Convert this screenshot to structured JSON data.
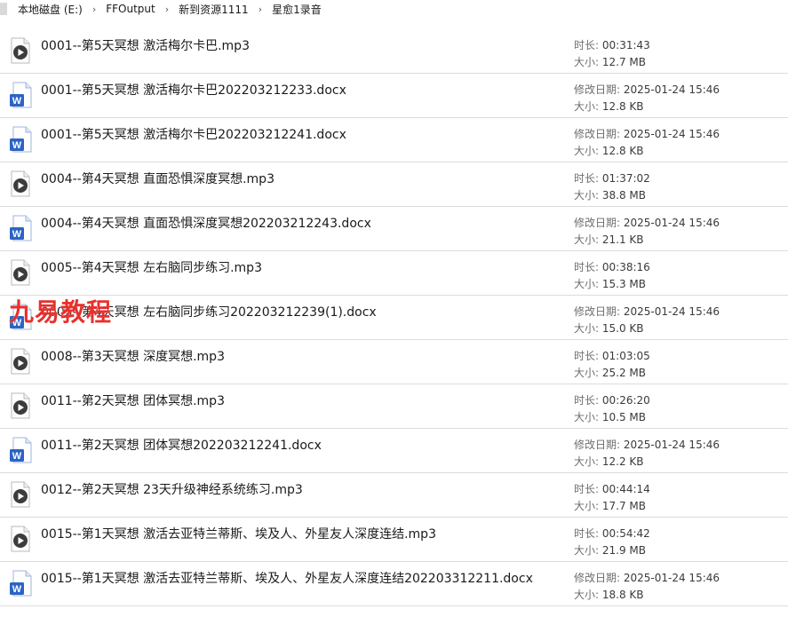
{
  "breadcrumb": {
    "items": [
      "本地磁盘 (E:)",
      "FFOutput",
      "新到资源1111",
      "星愈1录音"
    ],
    "separator": "›"
  },
  "watermark": "九易教程",
  "files": [
    {
      "name": "0001--第5天冥想 激活梅尔卡巴.mp3",
      "type": "mp3",
      "icon": "audio-file-icon",
      "meta1_label": "时长:",
      "meta1_value": "00:31:43",
      "meta2_label": "大小:",
      "meta2_value": "12.7 MB"
    },
    {
      "name": "0001--第5天冥想 激活梅尔卡巴202203212233.docx",
      "type": "docx",
      "icon": "word-document-icon",
      "meta1_label": "修改日期:",
      "meta1_value": "2025-01-24 15:46",
      "meta2_label": "大小:",
      "meta2_value": "12.8 KB"
    },
    {
      "name": "0001--第5天冥想 激活梅尔卡巴202203212241.docx",
      "type": "docx",
      "icon": "word-document-icon",
      "meta1_label": "修改日期:",
      "meta1_value": "2025-01-24 15:46",
      "meta2_label": "大小:",
      "meta2_value": "12.8 KB"
    },
    {
      "name": "0004--第4天冥想  直面恐惧深度冥想.mp3",
      "type": "mp3",
      "icon": "audio-file-icon",
      "meta1_label": "时长:",
      "meta1_value": "01:37:02",
      "meta2_label": "大小:",
      "meta2_value": "38.8 MB"
    },
    {
      "name": "0004--第4天冥想  直面恐惧深度冥想202203212243.docx",
      "type": "docx",
      "icon": "word-document-icon",
      "meta1_label": "修改日期:",
      "meta1_value": "2025-01-24 15:46",
      "meta2_label": "大小:",
      "meta2_value": "21.1 KB"
    },
    {
      "name": "0005--第4天冥想  左右脑同步练习.mp3",
      "type": "mp3",
      "icon": "audio-file-icon",
      "meta1_label": "时长:",
      "meta1_value": "00:38:16",
      "meta2_label": "大小:",
      "meta2_value": "15.3 MB"
    },
    {
      "name": "0005--第4天冥想  左右脑同步练习202203212239(1).docx",
      "type": "docx",
      "icon": "word-document-icon",
      "meta1_label": "修改日期:",
      "meta1_value": "2025-01-24 15:46",
      "meta2_label": "大小:",
      "meta2_value": "15.0 KB"
    },
    {
      "name": "0008--第3天冥想 深度冥想.mp3",
      "type": "mp3",
      "icon": "audio-file-icon",
      "meta1_label": "时长:",
      "meta1_value": "01:03:05",
      "meta2_label": "大小:",
      "meta2_value": "25.2 MB"
    },
    {
      "name": "0011--第2天冥想 团体冥想.mp3",
      "type": "mp3",
      "icon": "audio-file-icon",
      "meta1_label": "时长:",
      "meta1_value": "00:26:20",
      "meta2_label": "大小:",
      "meta2_value": "10.5 MB"
    },
    {
      "name": "0011--第2天冥想 团体冥想202203212241.docx",
      "type": "docx",
      "icon": "word-document-icon",
      "meta1_label": "修改日期:",
      "meta1_value": "2025-01-24 15:46",
      "meta2_label": "大小:",
      "meta2_value": "12.2 KB"
    },
    {
      "name": "0012--第2天冥想 23天升级神经系统练习.mp3",
      "type": "mp3",
      "icon": "audio-file-icon",
      "meta1_label": "时长:",
      "meta1_value": "00:44:14",
      "meta2_label": "大小:",
      "meta2_value": "17.7 MB"
    },
    {
      "name": "0015--第1天冥想 激活去亚特兰蒂斯、埃及人、外星友人深度连结.mp3",
      "type": "mp3",
      "icon": "audio-file-icon",
      "meta1_label": "时长:",
      "meta1_value": "00:54:42",
      "meta2_label": "大小:",
      "meta2_value": "21.9 MB"
    },
    {
      "name": "0015--第1天冥想 激活去亚特兰蒂斯、埃及人、外星友人深度连结202203312211.docx",
      "type": "docx",
      "icon": "word-document-icon",
      "meta1_label": "修改日期:",
      "meta1_value": "2025-01-24 15:46",
      "meta2_label": "大小:",
      "meta2_value": "18.8 KB"
    }
  ],
  "colors": {
    "word_blue": "#2b64c5",
    "watermark_red": "#e8302c",
    "divider": "#dcdcdc"
  }
}
